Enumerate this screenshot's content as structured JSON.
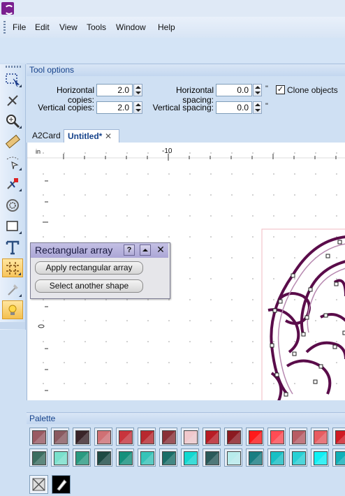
{
  "menus": [
    "File",
    "Edit",
    "View",
    "Tools",
    "Window",
    "Help"
  ],
  "tool_options": {
    "title": "Tool options",
    "horizontal_copies_label": "Horizontal copies:",
    "horizontal_copies_value": "2.0",
    "vertical_copies_label": "Vertical copies:",
    "vertical_copies_value": "2.0",
    "horizontal_spacing_label": "Horizontal spacing:",
    "horizontal_spacing_value": "0.0",
    "vertical_spacing_label": "Vertical spacing:",
    "vertical_spacing_value": "0.0",
    "unit": "\"",
    "clone_objects_label": "Clone objects",
    "clone_objects_checked": true
  },
  "tabs": [
    {
      "label": "A2Card",
      "active": false
    },
    {
      "label": "Untitled*",
      "active": true
    }
  ],
  "canvas": {
    "ruler_unit": "in",
    "ruler_label": "-10"
  },
  "array_dialog": {
    "title": "Rectangular array",
    "help_label": "?",
    "apply_label": "Apply rectangular array",
    "select_label": "Select another shape"
  },
  "palette": {
    "title": "Palette",
    "row1": [
      "#9a5a62",
      "#8a5a60",
      "#3a2428",
      "#d07074",
      "#c8343c",
      "#b8282e",
      "#8a3036",
      "#f0c8cc",
      "#b81c24",
      "#8c1a20",
      "#ff1a1a",
      "#ff4c54",
      "#b85c64",
      "#e85c60",
      "#d01c24"
    ],
    "row2": [
      "#3c6e60",
      "#7ae0cc",
      "#2a9a80",
      "#1e4a44",
      "#14907c",
      "#36c4b8",
      "#1a6e68",
      "#12d8d0",
      "#2a5a5a",
      "#b8ecec",
      "#1a7e82",
      "#18c0c4",
      "#28d0d4",
      "#10f0f4",
      "#10b0b8"
    ]
  },
  "tools": [
    "select-tool",
    "knife-tool",
    "zoom-tool",
    "ruler-tool",
    "trace-tool",
    "node-edit-tool",
    "rhinestone-tool",
    "rectangle-tool",
    "text-tool",
    "array-tool",
    "eyedropper-tool",
    "tip-tool"
  ]
}
